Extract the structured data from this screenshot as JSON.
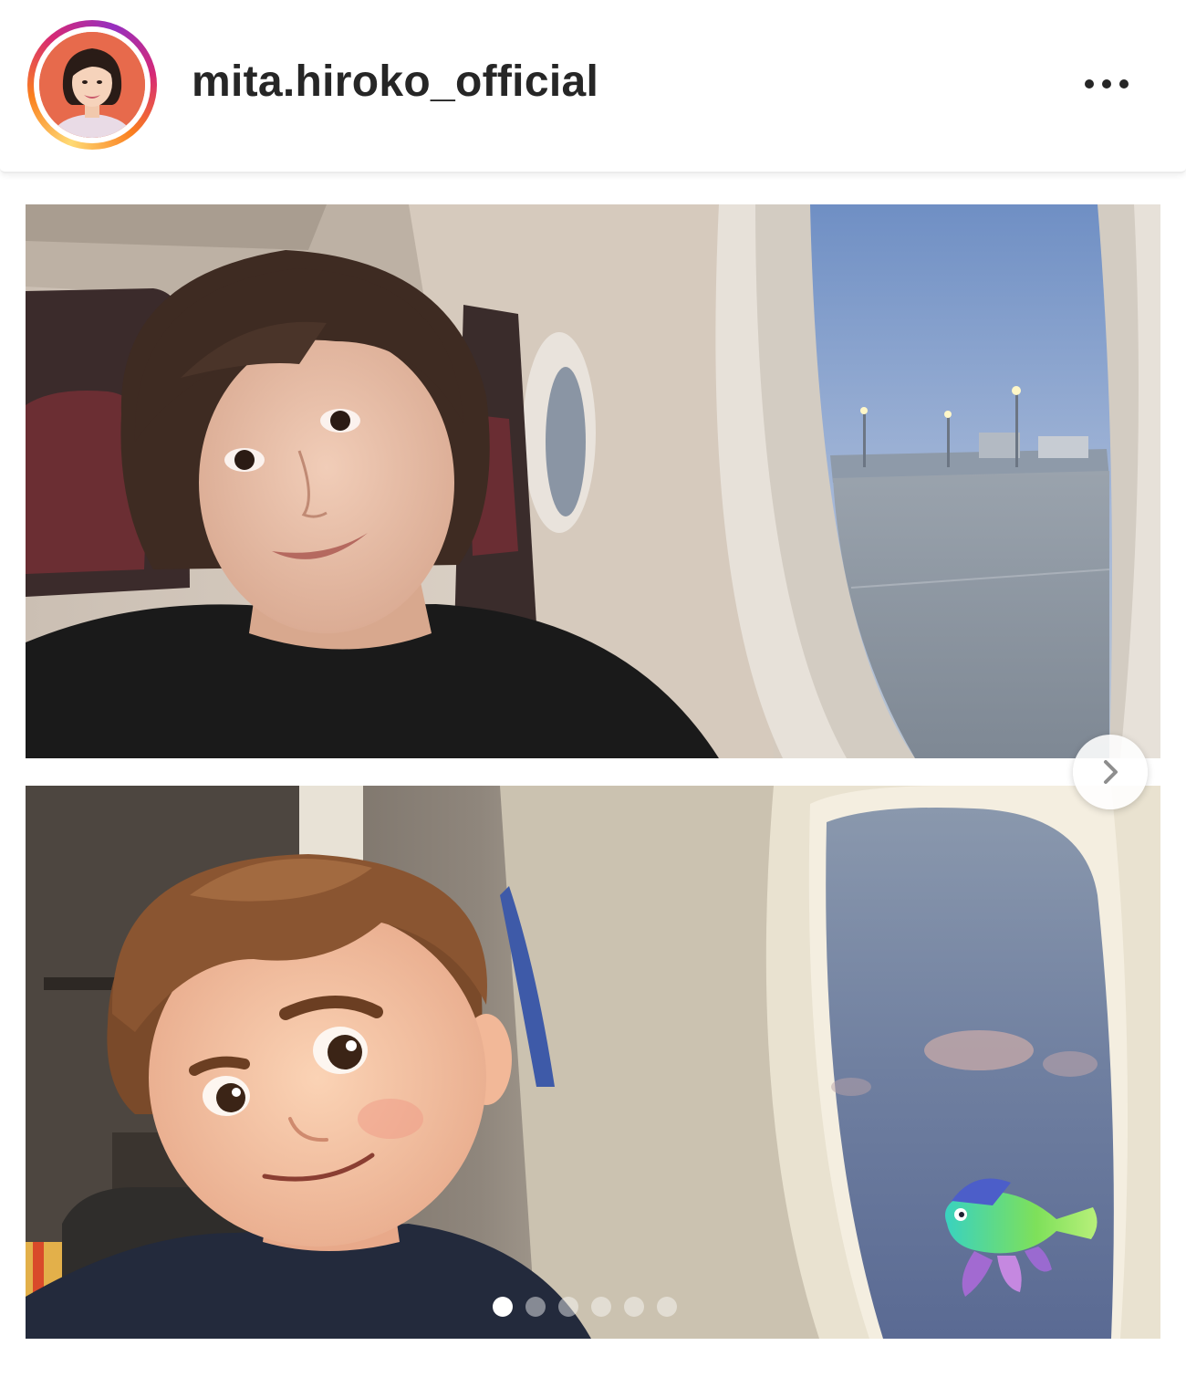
{
  "post": {
    "username": "mita.hiroko_official",
    "carousel": {
      "current_index": 1,
      "total": 6
    }
  },
  "icons": {
    "more": "more-horizontal-icon",
    "next": "chevron-right-icon"
  },
  "colors": {
    "story_ring_start": "#feda75",
    "story_ring_mid": "#d62976",
    "story_ring_end": "#962fbf",
    "username_text": "#262626",
    "avatar_background": "#e76a4c"
  }
}
